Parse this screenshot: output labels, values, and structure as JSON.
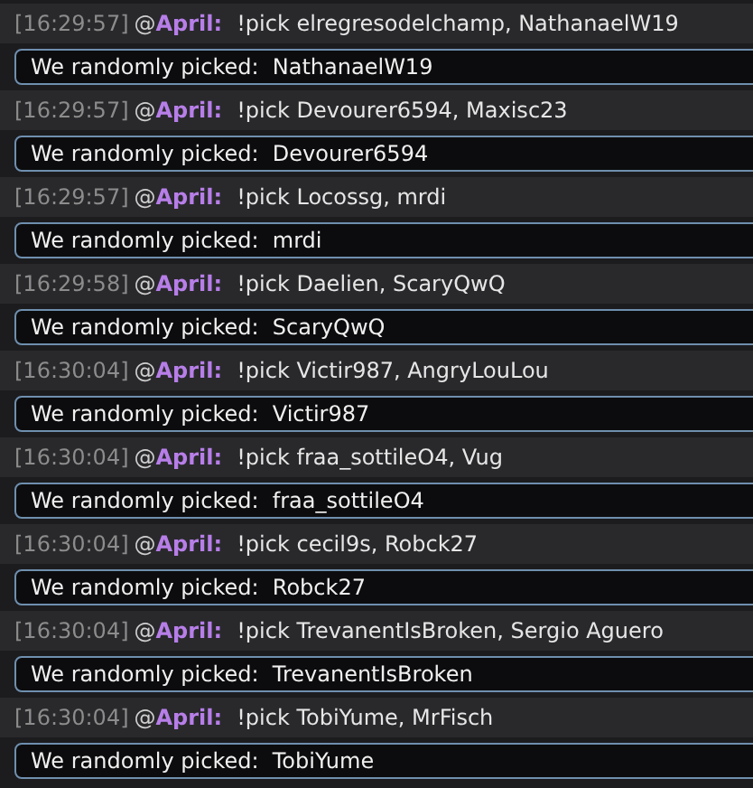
{
  "messages": [
    {
      "time": "[16:29:57]",
      "at": "@",
      "user": "April:",
      "text": "!pick elregresodelchamp, NathanaelW19",
      "reply": "We randomly picked:  NathanaelW19"
    },
    {
      "time": "[16:29:57]",
      "at": "@",
      "user": "April:",
      "text": "!pick Devourer6594, Maxisc23",
      "reply": "We randomly picked:  Devourer6594"
    },
    {
      "time": "[16:29:57]",
      "at": "@",
      "user": "April:",
      "text": "!pick Locossg, mrdi",
      "reply": "We randomly picked:  mrdi"
    },
    {
      "time": "[16:29:58]",
      "at": "@",
      "user": "April:",
      "text": "!pick Daelien, ScaryQwQ",
      "reply": "We randomly picked:  ScaryQwQ"
    },
    {
      "time": "[16:30:04]",
      "at": "@",
      "user": "April:",
      "text": "!pick Victir987, AngryLouLou",
      "reply": "We randomly picked:  Victir987"
    },
    {
      "time": "[16:30:04]",
      "at": "@",
      "user": "April:",
      "text": "!pick fraa_sottileO4, Vug",
      "reply": "We randomly picked:  fraa_sottileO4"
    },
    {
      "time": "[16:30:04]",
      "at": "@",
      "user": "April:",
      "text": "!pick cecil9s, Robck27",
      "reply": "We randomly picked:  Robck27"
    },
    {
      "time": "[16:30:04]",
      "at": "@",
      "user": "April:",
      "text": "!pick TrevanentIsBroken, Sergio Aguero",
      "reply": "We randomly picked:  TrevanentIsBroken"
    },
    {
      "time": "[16:30:04]",
      "at": "@",
      "user": "April:",
      "text": "!pick TobiYume, MrFisch",
      "reply": "We randomly picked:  TobiYume"
    }
  ]
}
